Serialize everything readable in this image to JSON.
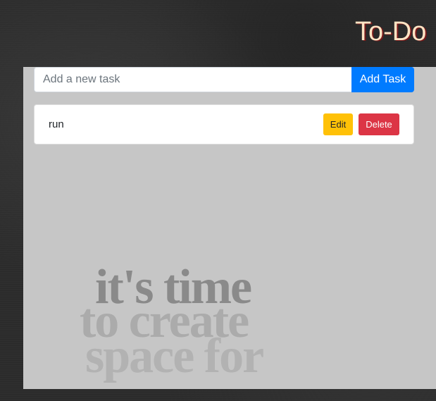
{
  "header": {
    "title": "To-Do"
  },
  "form": {
    "placeholder": "Add a new task",
    "value": "",
    "add_label": "Add Task"
  },
  "tasks": [
    {
      "text": "run",
      "edit_label": "Edit",
      "delete_label": "Delete"
    }
  ],
  "artwork": {
    "lines": [
      "it's time",
      "to create",
      "space for"
    ]
  },
  "colors": {
    "title": "#ffe4c4",
    "panel": "#c6c6c6",
    "add": "#007bff",
    "edit": "#ffc107",
    "delete": "#dc3545"
  }
}
